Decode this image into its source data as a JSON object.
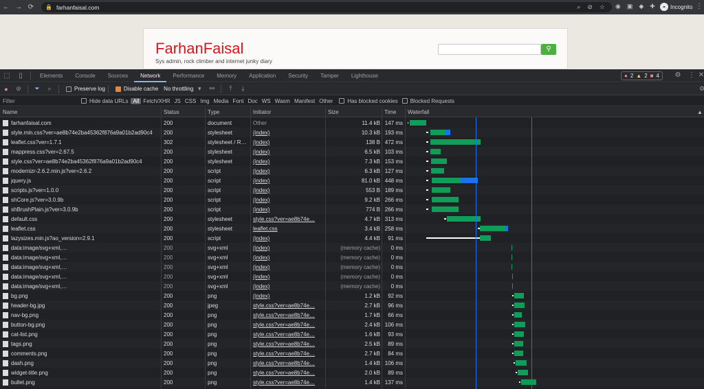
{
  "browser": {
    "url": "farhanfaisal.com",
    "profile_label": "Incognito"
  },
  "site": {
    "title": "FarhanFaisal",
    "tagline": "Sys admin, rock climber and internet junky diary",
    "search_value": ""
  },
  "devtools": {
    "tabs": [
      "Elements",
      "Console",
      "Sources",
      "Network",
      "Performance",
      "Memory",
      "Application",
      "Security",
      "Tamper",
      "Lighthouse"
    ],
    "active_tab": "Network",
    "issues": {
      "errors": "2",
      "warnings": "2",
      "info": "4"
    },
    "toolbar": {
      "preserve_log": "Preserve log",
      "disable_cache": "Disable cache",
      "throttling": "No throttling"
    },
    "filter": {
      "placeholder": "Filter",
      "hide_data_urls": "Hide data URLs",
      "types": [
        "All",
        "Fetch/XHR",
        "JS",
        "CSS",
        "Img",
        "Media",
        "Font",
        "Doc",
        "WS",
        "Wasm",
        "Manifest",
        "Other"
      ],
      "active_type": "All",
      "has_blocked_cookies": "Has blocked cookies",
      "blocked_requests": "Blocked Requests"
    },
    "columns": {
      "name": "Name",
      "status": "Status",
      "type": "Type",
      "initiator": "Initiator",
      "size": "Size",
      "time": "Time",
      "waterfall": "Waterfall"
    },
    "rows": [
      {
        "name": "farhanfaisal.com",
        "status": "200",
        "type": "document",
        "initiator": "Other",
        "size": "11.4 kB",
        "time": "147 ms",
        "icon": "document-icon"
      },
      {
        "name": "style.min.css?ver=ae8b74e2ba45362f876a9a01b2ad90c4",
        "status": "200",
        "type": "stylesheet",
        "initiator": "(index)",
        "size": "10.3 kB",
        "time": "193 ms",
        "icon": "css-file-icon"
      },
      {
        "name": "leaflet.css?ver=1.7.1",
        "status": "302",
        "type": "stylesheet / R…",
        "initiator": "(index)",
        "size": "138 B",
        "time": "472 ms",
        "icon": "css-file-icon"
      },
      {
        "name": "mappress.css?ver=2.67.5",
        "status": "200",
        "type": "stylesheet",
        "initiator": "(index)",
        "size": "6.5 kB",
        "time": "103 ms",
        "icon": "css-file-icon"
      },
      {
        "name": "style.css?ver=ae8b74e2ba45362f876a9a01b2ad90c4",
        "status": "200",
        "type": "stylesheet",
        "initiator": "(index)",
        "size": "7.3 kB",
        "time": "153 ms",
        "icon": "css-file-icon"
      },
      {
        "name": "modernizr-2.6.2.min.js?ver=2.6.2",
        "status": "200",
        "type": "script",
        "initiator": "(index)",
        "size": "6.3 kB",
        "time": "127 ms",
        "icon": "js-file-icon"
      },
      {
        "name": "jquery.js",
        "status": "200",
        "type": "script",
        "initiator": "(index)",
        "size": "81.0 kB",
        "time": "448 ms",
        "icon": "js-file-icon"
      },
      {
        "name": "scripts.js?ver=1.0.0",
        "status": "200",
        "type": "script",
        "initiator": "(index)",
        "size": "553 B",
        "time": "189 ms",
        "icon": "js-file-icon"
      },
      {
        "name": "shCore.js?ver=3.0.9b",
        "status": "200",
        "type": "script",
        "initiator": "(index)",
        "size": "9.2 kB",
        "time": "266 ms",
        "icon": "js-file-icon"
      },
      {
        "name": "shBrushPlain.js?ver=3.0.9b",
        "status": "200",
        "type": "script",
        "initiator": "(index)",
        "size": "774 B",
        "time": "266 ms",
        "icon": "js-file-icon"
      },
      {
        "name": "default.css",
        "status": "200",
        "type": "stylesheet",
        "initiator": "style.css?ver=ae8b74e…",
        "size": "4.7 kB",
        "time": "313 ms",
        "icon": "css-file-icon"
      },
      {
        "name": "leaflet.css",
        "status": "200",
        "type": "stylesheet",
        "initiator": "leaflet.css",
        "size": "3.4 kB",
        "time": "258 ms",
        "icon": "css-file-icon"
      },
      {
        "name": "lazysizes.min.js?ao_version=2.9.1",
        "status": "200",
        "type": "script",
        "initiator": "(index)",
        "size": "4.4 kB",
        "time": "91 ms",
        "icon": "js-file-icon"
      },
      {
        "name": "data:image/svg+xml,…",
        "status": "200",
        "type": "svg+xml",
        "initiator": "(index)",
        "size": "(memory cache)",
        "time": "0 ms",
        "icon": "image-file-icon"
      },
      {
        "name": "data:image/svg+xml,…",
        "status": "200",
        "type": "svg+xml",
        "initiator": "(index)",
        "size": "(memory cache)",
        "time": "0 ms",
        "icon": "image-file-icon"
      },
      {
        "name": "data:image/svg+xml,…",
        "status": "200",
        "type": "svg+xml",
        "initiator": "(index)",
        "size": "(memory cache)",
        "time": "0 ms",
        "icon": "image-file-icon"
      },
      {
        "name": "data:image/svg+xml,…",
        "status": "200",
        "type": "svg+xml",
        "initiator": "(index)",
        "size": "(memory cache)",
        "time": "0 ms",
        "icon": "image-file-icon"
      },
      {
        "name": "data:image/svg+xml,…",
        "status": "200",
        "type": "svg+xml",
        "initiator": "(index)",
        "size": "(memory cache)",
        "time": "0 ms",
        "icon": "image-file-icon"
      },
      {
        "name": "bg.png",
        "status": "200",
        "type": "png",
        "initiator": "(index)",
        "size": "1.2 kB",
        "time": "92 ms",
        "icon": "image-file-icon"
      },
      {
        "name": "header-bg.jpg",
        "status": "200",
        "type": "jpeg",
        "initiator": "style.css?ver=ae8b74e…",
        "size": "2.7 kB",
        "time": "96 ms",
        "icon": "image-file-icon"
      },
      {
        "name": "nav-bg.png",
        "status": "200",
        "type": "png",
        "initiator": "style.css?ver=ae8b74e…",
        "size": "1.7 kB",
        "time": "66 ms",
        "icon": "image-file-icon"
      },
      {
        "name": "button-bg.png",
        "status": "200",
        "type": "png",
        "initiator": "style.css?ver=ae8b74e…",
        "size": "2.4 kB",
        "time": "106 ms",
        "icon": "image-file-icon"
      },
      {
        "name": "cat-list.png",
        "status": "200",
        "type": "png",
        "initiator": "style.css?ver=ae8b74e…",
        "size": "1.6 kB",
        "time": "93 ms",
        "icon": "image-file-icon"
      },
      {
        "name": "tags.png",
        "status": "200",
        "type": "png",
        "initiator": "style.css?ver=ae8b74e…",
        "size": "2.5 kB",
        "time": "89 ms",
        "icon": "image-file-icon"
      },
      {
        "name": "comments.png",
        "status": "200",
        "type": "png",
        "initiator": "style.css?ver=ae8b74e…",
        "size": "2.7 kB",
        "time": "84 ms",
        "icon": "image-file-icon"
      },
      {
        "name": "dash.png",
        "status": "200",
        "type": "png",
        "initiator": "style.css?ver=ae8b74e…",
        "size": "1.4 kB",
        "time": "106 ms",
        "icon": "image-file-icon"
      },
      {
        "name": "widget-title.png",
        "status": "200",
        "type": "png",
        "initiator": "style.css?ver=ae8b74e…",
        "size": "2.0 kB",
        "time": "89 ms",
        "icon": "image-file-icon"
      },
      {
        "name": "bullet.png",
        "status": "200",
        "type": "png",
        "initiator": "style.css?ver=ae8b74e…",
        "size": "1.4 kB",
        "time": "137 ms",
        "icon": "image-file-icon"
      }
    ]
  },
  "colors": {
    "accent": "#8ab4f8",
    "site_title": "#d9141b",
    "search_button": "#4fae42",
    "wait_bar": "#0f9d58",
    "download_bar": "#1a73e8"
  }
}
